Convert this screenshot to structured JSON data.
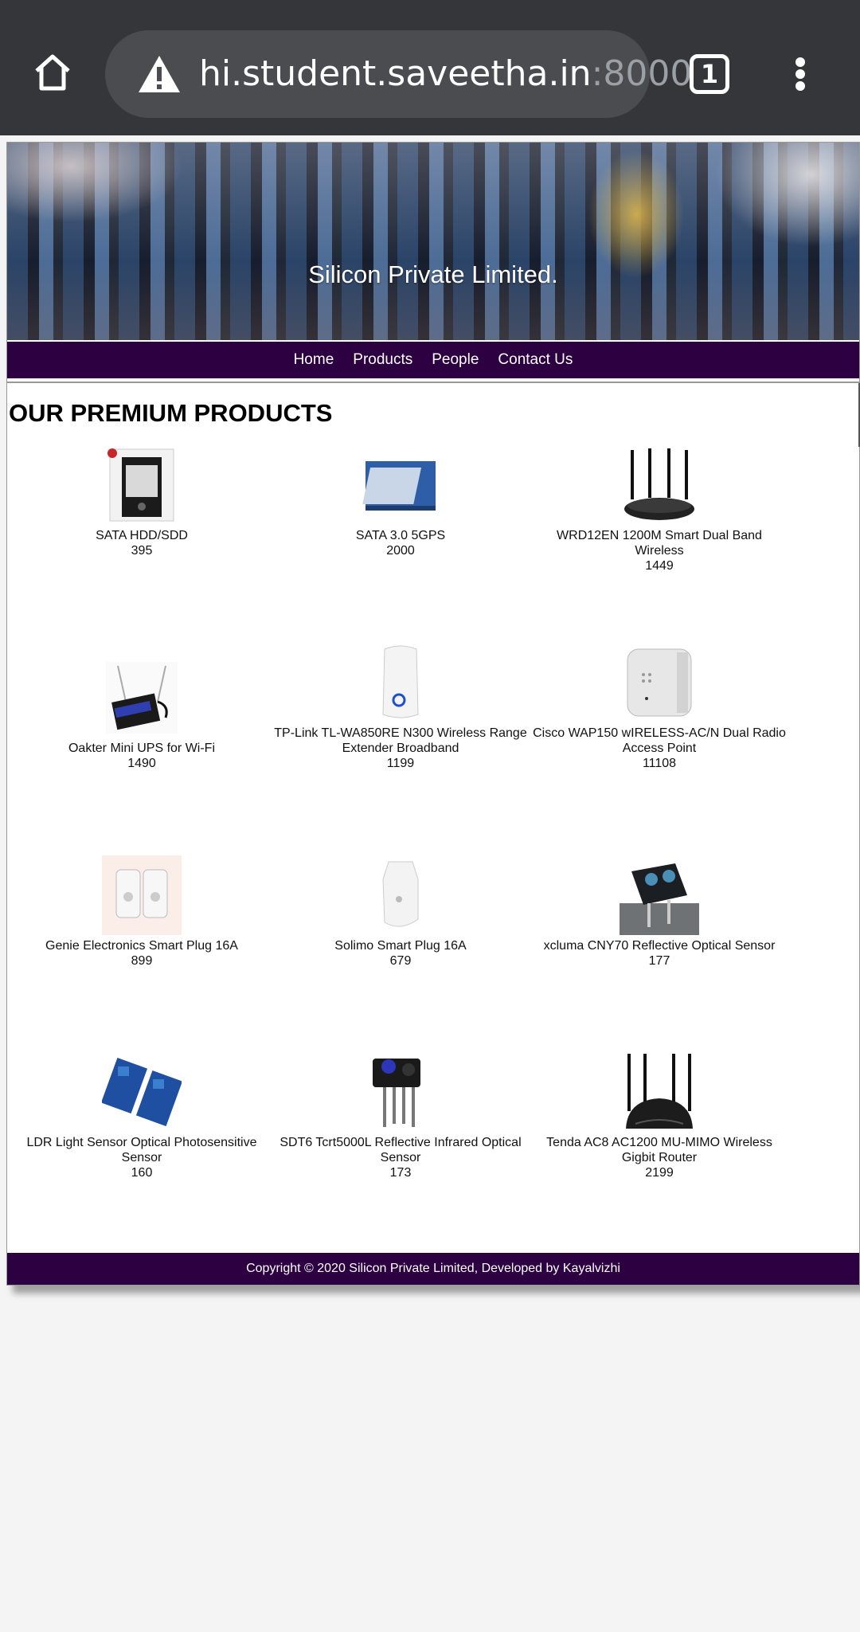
{
  "browser": {
    "url_host": "hi.student.saveetha.in",
    "url_port": ":8000",
    "tab_count": "1",
    "icons": [
      "home-icon",
      "warning-icon",
      "tabs-icon",
      "more-vert-icon"
    ]
  },
  "site": {
    "title": "Silicon Private Limited.",
    "nav": [
      "Home",
      "Products",
      "People",
      "Contact Us"
    ],
    "heading": "OUR PREMIUM PRODUCTS",
    "footer": "Copyright © 2020 Silicon Private Limited, Developed by Kayalvizhi",
    "colors": {
      "nav_bg": "#2c0041",
      "footer_bg": "#2c0041"
    }
  },
  "products": [
    {
      "name": "SATA HDD/SDD",
      "price": "395"
    },
    {
      "name": "SATA 3.0 5GPS",
      "price": "2000"
    },
    {
      "name": "WRD12EN 1200M Smart Dual Band Wireless",
      "price": "1449"
    },
    {
      "name": "Oakter Mini UPS for Wi-Fi",
      "price": "1490"
    },
    {
      "name": "TP-Link TL-WA850RE N300 Wireless Range Extender Broadband",
      "price": "1199"
    },
    {
      "name": "Cisco WAP150 wIRELESS-AC/N Dual Radio Access Point",
      "price": "11108"
    },
    {
      "name": "Genie Electronics Smart Plug 16A",
      "price": "899"
    },
    {
      "name": "Solimo Smart Plug 16A",
      "price": "679"
    },
    {
      "name": "xcluma CNY70 Reflective Optical Sensor",
      "price": "177"
    },
    {
      "name": "LDR Light Sensor Optical Photosensitive Sensor",
      "price": "160"
    },
    {
      "name": "SDT6 Tcrt5000L Reflective Infrared Optical Sensor",
      "price": "173"
    },
    {
      "name": "Tenda AC8 AC1200 MU-MIMO Wireless Gigbit Router",
      "price": "2199"
    }
  ]
}
